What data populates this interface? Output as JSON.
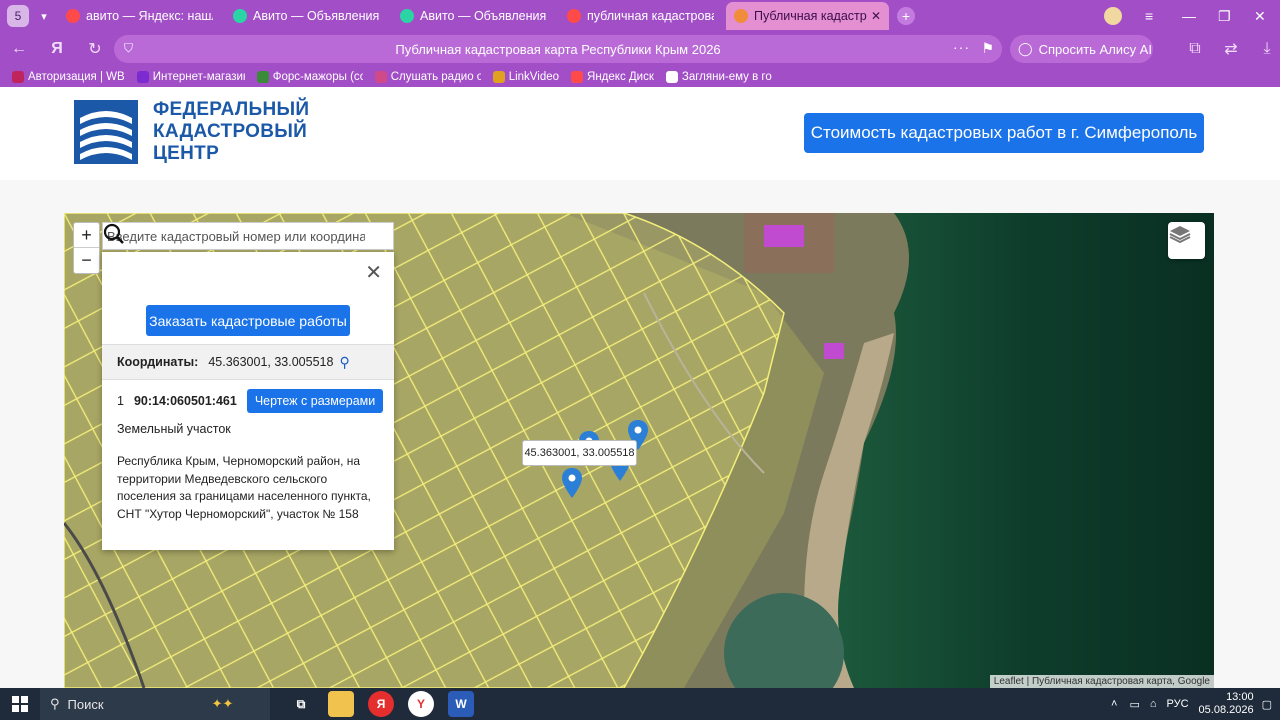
{
  "browser": {
    "tab_count": "5",
    "tabs": [
      {
        "label": "авито — Яндекс: нашлось",
        "color": "#ff4a4a",
        "active": false
      },
      {
        "label": "Авито — Объявления на с",
        "color": "#2bd4a4",
        "active": false
      },
      {
        "label": "Авито — Объявления на с",
        "color": "#2bd4a4",
        "active": false
      },
      {
        "label": "публичная кадастровая к",
        "color": "#ff4a4a",
        "active": false
      },
      {
        "label": "Публичная кадастрова",
        "color": "#f08c3a",
        "active": true
      }
    ],
    "page_title": "Публичная кадастровая карта Республики Крым 2026",
    "alice_label": "Спросить Алису AI",
    "bookmarks": [
      {
        "label": "Авторизация | WB",
        "color": "#c0245c"
      },
      {
        "label": "Интернет-магазин",
        "color": "#7c2bd0"
      },
      {
        "label": "Форс-мажоры (со",
        "color": "#3a8a3a"
      },
      {
        "label": "Слушать радио он",
        "color": "#d04a8a"
      },
      {
        "label": "LinkVideo",
        "color": "#e0a020"
      },
      {
        "label": "Яндекс Диск",
        "color": "#ff4a4a"
      },
      {
        "label": "Загляни-ему в го",
        "color": "#ffffff"
      }
    ]
  },
  "site": {
    "logo_line1": "ФЕДЕРАЛЬНЫЙ",
    "logo_line2": "КАДАСТРОВЫЙ",
    "logo_line3": "ЦЕНТР",
    "cta_label": "Стоимость кадастровых работ в г. Симферополь"
  },
  "map": {
    "zoom_in": "+",
    "zoom_out": "−",
    "search_placeholder": "Введите кадастровый номер или координаты",
    "tooltip": "45.363001, 33.005518",
    "attribution": "Leaflet | Публичная кадастровая карта, Google"
  },
  "popup": {
    "order_button": "Заказать кадастровые работы",
    "coords_label": "Координаты:",
    "coords_value": "45.363001, 33.005518",
    "index": "1",
    "cadastral_number": "90:14:060501:461",
    "drawing_button": "Чертеж с размерами",
    "kind": "Земельный участок",
    "address": "Республика Крым, Черноморский район, на территории Медведевского сельского поселения за границами населенного пункта, СНТ \"Хутор Черноморский\", участок № 158"
  },
  "taskbar": {
    "search_label": "Поиск",
    "lang": "РУС",
    "time": "13:00",
    "date": "05.08.2026"
  }
}
